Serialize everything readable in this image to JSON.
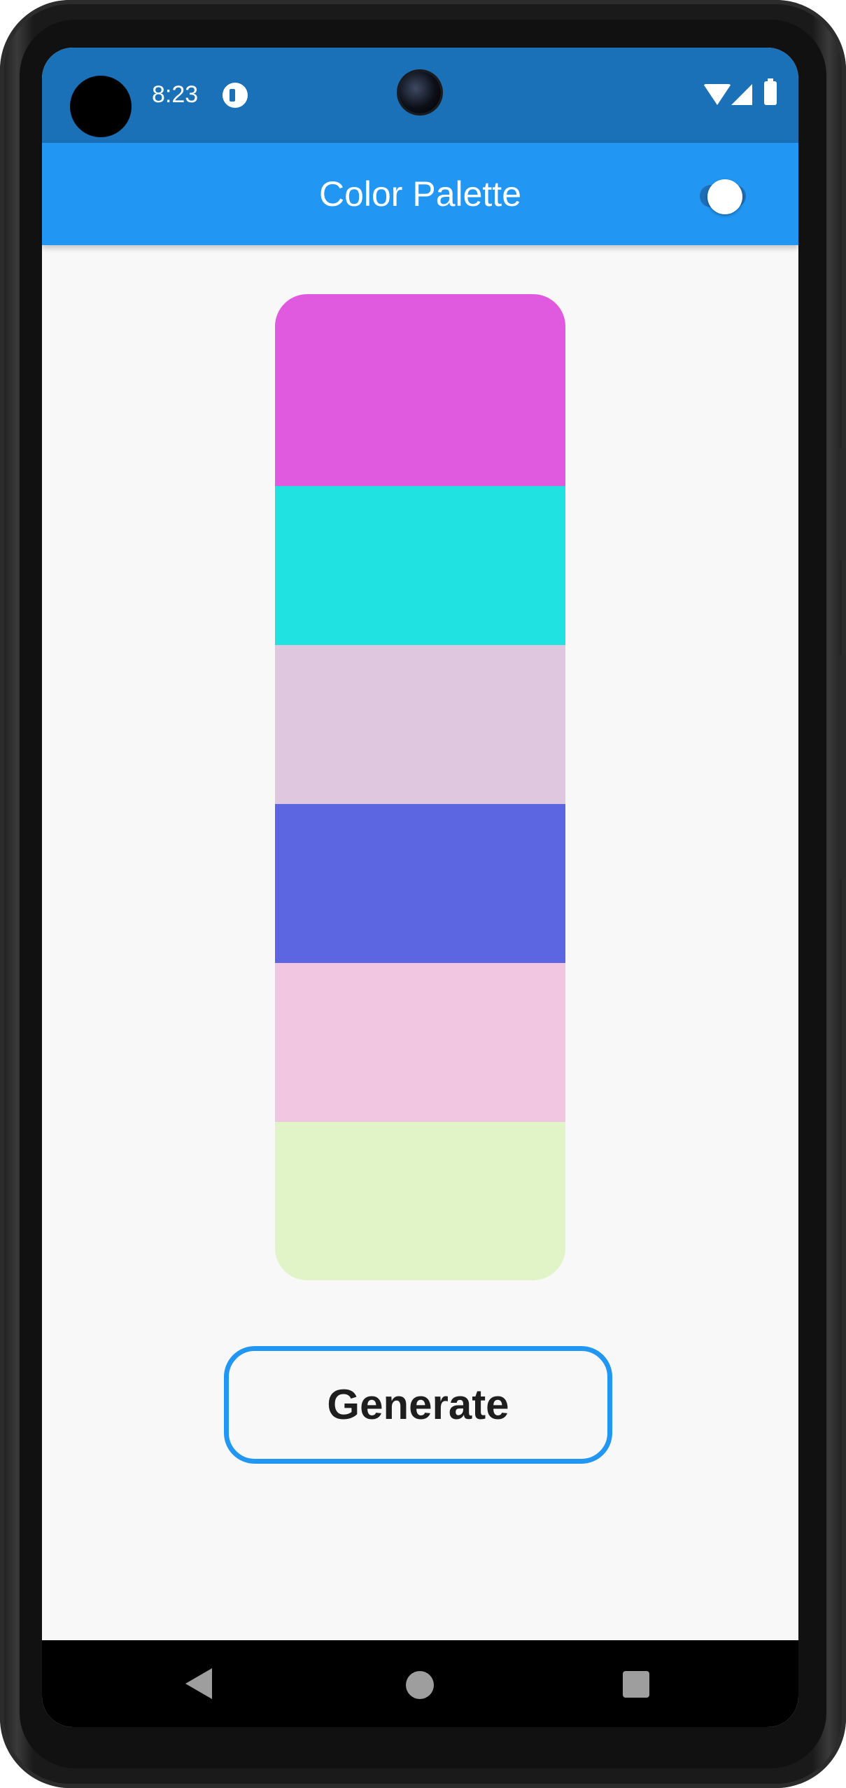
{
  "status_bar": {
    "time": "8:23",
    "background_color": "#1a71b8",
    "icons": [
      "notification-icon",
      "wifi-icon",
      "cellular-signal-icon",
      "battery-icon"
    ]
  },
  "app_bar": {
    "title": "Color Palette",
    "background_color": "#2296f3",
    "theme_toggle": {
      "on": false
    }
  },
  "palette": {
    "swatches": [
      {
        "color": "#e05ae0"
      },
      {
        "color": "#20e2e0"
      },
      {
        "color": "#dfc7e0"
      },
      {
        "color": "#5b66e0"
      },
      {
        "color": "#f1c6e0"
      },
      {
        "color": "#e0f4c7"
      }
    ]
  },
  "actions": {
    "generate_label": "Generate",
    "accent_color": "#2296f3"
  },
  "nav_bar": {
    "icons": [
      "back-icon",
      "home-icon",
      "recents-icon"
    ]
  }
}
